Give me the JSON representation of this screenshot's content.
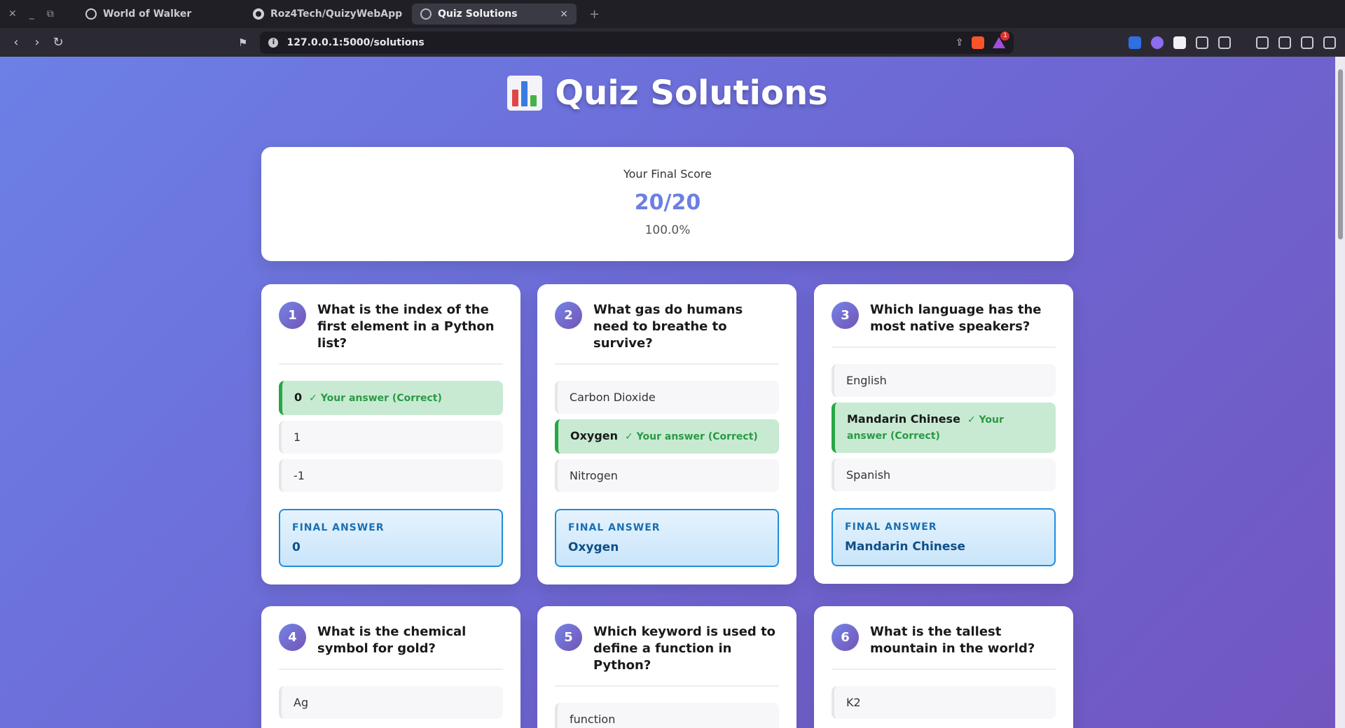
{
  "browser": {
    "tabs": [
      {
        "title": "World of Walker",
        "active": false
      },
      {
        "title": "Roz4Tech/QuizyWebApp",
        "active": false
      },
      {
        "title": "Quiz Solutions",
        "active": true
      }
    ],
    "close_tab": "×",
    "new_tab": "+",
    "url": "127.0.0.1:5000/solutions",
    "notification_count": "1"
  },
  "page": {
    "title": "Quiz Solutions",
    "title_icon": "bar-chart-icon"
  },
  "score": {
    "label": "Your Final Score",
    "value": "20/20",
    "percent": "100.0%"
  },
  "final_answer_label": "FINAL ANSWER",
  "questions": [
    {
      "number": "1",
      "text": "What is the index of the first element in a Python list?",
      "options": [
        {
          "text": "0",
          "note": "✓ Your answer (Correct)",
          "correct": true
        },
        {
          "text": "1",
          "note": "",
          "correct": false
        },
        {
          "text": "-1",
          "note": "",
          "correct": false
        }
      ],
      "final_answer": "0"
    },
    {
      "number": "2",
      "text": "What gas do humans need to breathe to survive?",
      "options": [
        {
          "text": "Carbon Dioxide",
          "note": "",
          "correct": false
        },
        {
          "text": "Oxygen",
          "note": "✓ Your answer (Correct)",
          "correct": true
        },
        {
          "text": "Nitrogen",
          "note": "",
          "correct": false
        }
      ],
      "final_answer": "Oxygen"
    },
    {
      "number": "3",
      "text": "Which language has the most native speakers?",
      "options": [
        {
          "text": "English",
          "note": "",
          "correct": false
        },
        {
          "text": "Mandarin Chinese",
          "note": "✓ Your answer (Correct)",
          "correct": true
        },
        {
          "text": "Spanish",
          "note": "",
          "correct": false
        }
      ],
      "final_answer": "Mandarin Chinese"
    },
    {
      "number": "4",
      "text": "What is the chemical symbol for gold?",
      "options": [
        {
          "text": "Ag",
          "note": "",
          "correct": false
        }
      ]
    },
    {
      "number": "5",
      "text": "Which keyword is used to define a function in Python?",
      "options": [
        {
          "text": "function",
          "note": "",
          "correct": false
        }
      ]
    },
    {
      "number": "6",
      "text": "What is the tallest mountain in the world?",
      "options": [
        {
          "text": "K2",
          "note": "",
          "correct": false
        }
      ]
    }
  ]
}
